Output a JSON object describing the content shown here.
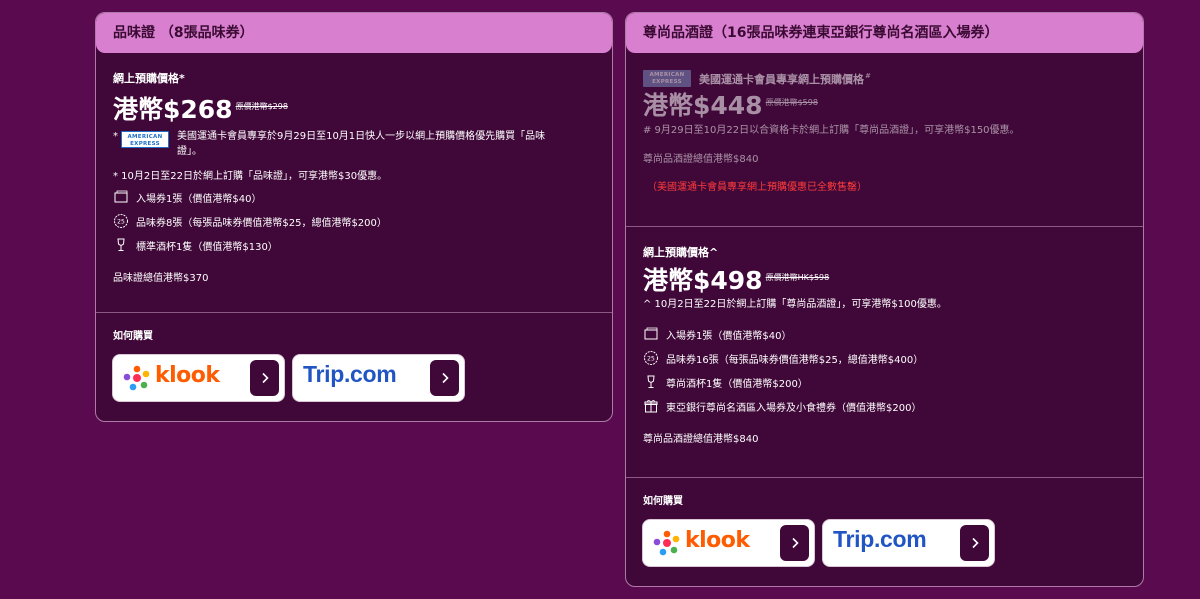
{
  "card1": {
    "title": "品味證 （8張品味券）",
    "presale_label": "網上預購價格*",
    "price": "港幣$268",
    "orig_price": "原價港幣$298",
    "amex_note_prefix": "*",
    "amex_logo_text": "AMERICAN EXPRESS",
    "amex_note_line1": "美國運通卡會員專享於9月29日至10月1日快人一步以網上預購價格優先購買「品味",
    "amex_note_line2": "證」。",
    "discount_note": "* 10月2日至22日於網上訂購「品味證」，可享港幣$30優惠。",
    "items": [
      {
        "icon": "ticket-icon",
        "text": "入場券1張（價值港幣$40）"
      },
      {
        "icon": "tasting-coupon-icon",
        "text": "品味券8張（每張品味券價值港幣$25，總值港幣$200）"
      },
      {
        "icon": "wine-glass-icon",
        "text": "標準酒杯1隻（價值港幣$130）"
      }
    ],
    "total": "品味證總值港幣$370",
    "how_to_buy": "如何購買",
    "klook_label": "klook",
    "trip_label": "Trip.com"
  },
  "card2": {
    "title": "尊尚品酒證（16張品味券連東亞銀行尊尚名酒區入場券）",
    "amex_logo_text": "AMERICAN EXPRESS",
    "amex_label": "美國運通卡會員專享網上預購價格",
    "amex_label_mark": "#",
    "amex_price": "港幣$448",
    "amex_orig_price": "原價港幣$598",
    "amex_note": "# 9月29日至10月22日以合資格卡於網上訂購「尊尚品酒證」，可享港幣$150優惠。",
    "amex_total": "尊尚品酒證總值港幣$840",
    "soldout": "（美國運通卡會員專享網上預購優惠已全數售罄）",
    "presale_label": "網上預購價格^",
    "price": "港幣$498",
    "orig_price": "原價港幣HK$598",
    "discount_note": "^ 10月2日至22日於網上訂購「尊尚品酒證」，可享港幣$100優惠。",
    "items": [
      {
        "icon": "ticket-icon",
        "text": "入場券1張（價值港幣$40）"
      },
      {
        "icon": "tasting-coupon-icon",
        "text": "品味券16張（每張品味券價值港幣$25，總值港幣$400）"
      },
      {
        "icon": "wine-glass-icon",
        "text": "尊尚酒杯1隻（價值港幣$200）"
      },
      {
        "icon": "gift-icon",
        "text": "東亞銀行尊尚名酒區入場券及小食禮券（價值港幣$200）"
      }
    ],
    "total": "尊尚品酒證總值港幣$840",
    "how_to_buy": "如何購買",
    "klook_label": "klook",
    "trip_label": "Trip.com"
  },
  "colors": {
    "background": "#5a0b4f",
    "card": "#3f0838",
    "header": "#d97fcf",
    "klook": "#ff5b00",
    "trip": "#2155c4",
    "warning": "#ff3b3b"
  }
}
